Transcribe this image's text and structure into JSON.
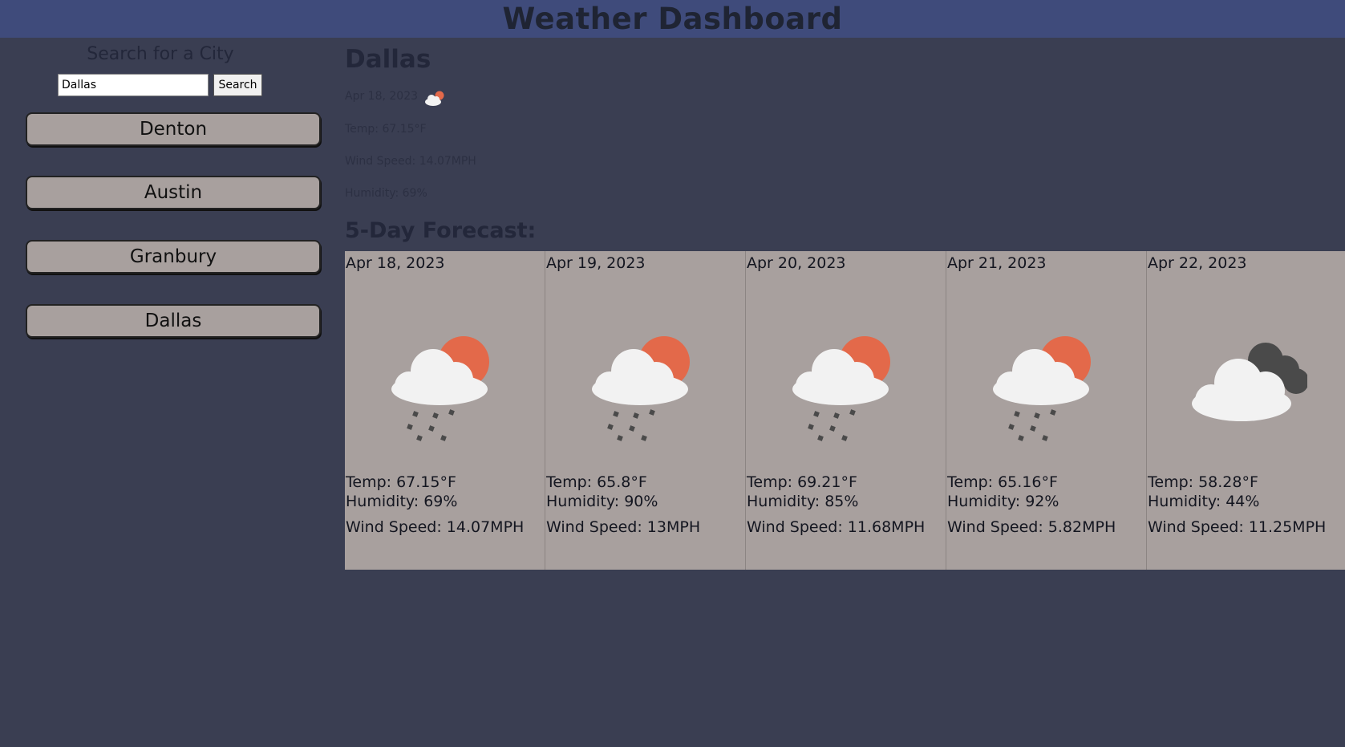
{
  "header": {
    "title": "Weather Dashboard"
  },
  "sidebar": {
    "search_title": "Search for a City",
    "search_value": "Dallas",
    "search_button": "Search",
    "history": [
      "Denton",
      "Austin",
      "Granbury",
      "Dallas"
    ]
  },
  "current": {
    "city": "Dallas",
    "date": "Apr 18, 2023",
    "icon": "cloud-sun-icon",
    "temp": "Temp: 67.15°F",
    "wind": "Wind Speed: 14.07MPH",
    "humidity": "Humidity: 69%"
  },
  "forecast": {
    "title": "5-Day Forecast:",
    "days": [
      {
        "date": "Apr 18, 2023",
        "icon": "rain-sun-icon",
        "temp": "Temp: 67.15°F",
        "humidity": "Humidity: 69%",
        "wind": "Wind Speed: 14.07MPH"
      },
      {
        "date": "Apr 19, 2023",
        "icon": "rain-sun-icon",
        "temp": "Temp: 65.8°F",
        "humidity": "Humidity: 90%",
        "wind": "Wind Speed: 13MPH"
      },
      {
        "date": "Apr 20, 2023",
        "icon": "rain-sun-icon",
        "temp": "Temp: 69.21°F",
        "humidity": "Humidity: 85%",
        "wind": "Wind Speed: 11.68MPH"
      },
      {
        "date": "Apr 21, 2023",
        "icon": "rain-sun-icon",
        "temp": "Temp: 65.16°F",
        "humidity": "Humidity: 92%",
        "wind": "Wind Speed: 5.82MPH"
      },
      {
        "date": "Apr 22, 2023",
        "icon": "overcast-clouds-icon",
        "temp": "Temp: 58.28°F",
        "humidity": "Humidity: 44%",
        "wind": "Wind Speed: 11.25MPH"
      }
    ]
  },
  "colors": {
    "background": "#3a3e52",
    "header": "#3f4b7b",
    "card": "#a8a09e",
    "sun": "#e3694a"
  }
}
